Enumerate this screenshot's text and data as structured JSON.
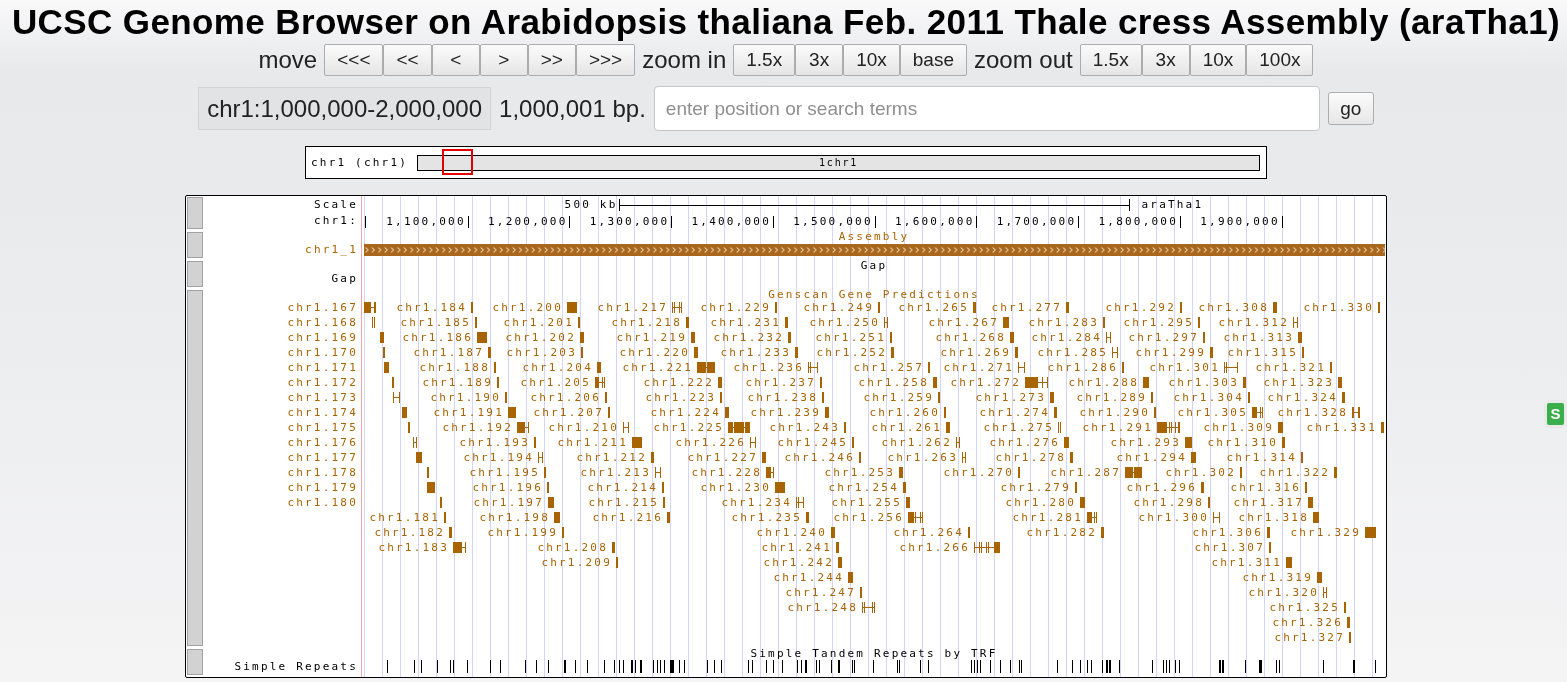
{
  "title": "UCSC Genome Browser on Arabidopsis thaliana Feb. 2011 Thale cress Assembly (araTha1)",
  "navigation": [
    {
      "label": "move",
      "buttons": [
        "<<<",
        "<<",
        "<",
        ">",
        ">>",
        ">>>"
      ]
    },
    {
      "label": "zoom in",
      "buttons": [
        "1.5x",
        "3x",
        "10x",
        "base"
      ]
    },
    {
      "label": "zoom out",
      "buttons": [
        "1.5x",
        "3x",
        "10x",
        "100x"
      ]
    }
  ],
  "position": {
    "value": "chr1:1,000,000-2,000,000",
    "size": "1,000,001 bp.",
    "search": {
      "placeholder": "enter position or search terms"
    },
    "go_button": "go"
  },
  "ideogram": {
    "label": "chr1 (chr1)",
    "band_label": "1chr1"
  },
  "tracks": [
    {
      "kind": "scale",
      "label": "Scale",
      "scale_bar": "500 kb",
      "assembly": "araTha1",
      "ruler_label": "chr1:",
      "ticks": [
        "1,100,000",
        "1,200,000",
        "1,300,000",
        "1,400,000",
        "1,500,000",
        "1,600,000",
        "1,700,000",
        "1,800,000",
        "1,900,000"
      ]
    },
    {
      "kind": "assembly",
      "title": "Assembly",
      "label": "chr1_1"
    },
    {
      "kind": "gap",
      "title": "Gap",
      "label": "Gap"
    },
    {
      "kind": "genes",
      "title": "Genscan Gene Predictions",
      "items": [
        "chr1.167",
        "chr1.184",
        "chr1.200",
        "chr1.217",
        "chr1.229",
        "chr1.249",
        "chr1.265",
        "chr1.277",
        "chr1.292",
        "chr1.308",
        "chr1.330",
        "chr1.168",
        "chr1.185",
        "chr1.201",
        "chr1.218",
        "chr1.231",
        "chr1.250",
        "chr1.267",
        "chr1.283",
        "chr1.295",
        "chr1.312",
        "chr1.169",
        "chr1.186",
        "chr1.202",
        "chr1.219",
        "chr1.232",
        "chr1.251",
        "chr1.268",
        "chr1.284",
        "chr1.297",
        "chr1.313",
        "chr1.170",
        "chr1.187",
        "chr1.203",
        "chr1.220",
        "chr1.233",
        "chr1.252",
        "chr1.269",
        "chr1.285",
        "chr1.299",
        "chr1.315",
        "chr1.171",
        "chr1.188",
        "chr1.204",
        "chr1.221",
        "chr1.236",
        "chr1.257",
        "chr1.271",
        "chr1.286",
        "chr1.301",
        "chr1.321",
        "chr1.172",
        "chr1.189",
        "chr1.205",
        "chr1.222",
        "chr1.237",
        "chr1.258",
        "chr1.272",
        "chr1.288",
        "chr1.303",
        "chr1.323",
        "chr1.173",
        "chr1.190",
        "chr1.206",
        "chr1.223",
        "chr1.238",
        "chr1.259",
        "chr1.273",
        "chr1.289",
        "chr1.304",
        "chr1.324",
        "chr1.174",
        "chr1.191",
        "chr1.207",
        "chr1.224",
        "chr1.239",
        "chr1.260",
        "chr1.274",
        "chr1.290",
        "chr1.305",
        "chr1.328",
        "chr1.175",
        "chr1.192",
        "chr1.210",
        "chr1.225",
        "chr1.243",
        "chr1.261",
        "chr1.275",
        "chr1.291",
        "chr1.309",
        "chr1.331",
        "chr1.176",
        "chr1.193",
        "chr1.211",
        "chr1.226",
        "chr1.245",
        "chr1.262",
        "chr1.276",
        "chr1.293",
        "chr1.310",
        "chr1.177",
        "chr1.194",
        "chr1.212",
        "chr1.227",
        "chr1.246",
        "chr1.263",
        "chr1.278",
        "chr1.294",
        "chr1.314",
        "chr1.178",
        "chr1.195",
        "chr1.213",
        "chr1.228",
        "chr1.253",
        "chr1.270",
        "chr1.287",
        "chr1.302",
        "chr1.322",
        "chr1.179",
        "chr1.196",
        "chr1.214",
        "chr1.230",
        "chr1.254",
        "chr1.279",
        "chr1.296",
        "chr1.316",
        "chr1.180",
        "chr1.197",
        "chr1.215",
        "chr1.234",
        "chr1.255",
        "chr1.280",
        "chr1.298",
        "chr1.317",
        "chr1.181",
        "chr1.198",
        "chr1.216",
        "chr1.235",
        "chr1.256",
        "chr1.281",
        "chr1.300",
        "chr1.318",
        "chr1.182",
        "chr1.199",
        "chr1.240",
        "chr1.264",
        "chr1.282",
        "chr1.306",
        "chr1.329",
        "chr1.183",
        "chr1.208",
        "chr1.241",
        "chr1.266",
        "chr1.307",
        "chr1.209",
        "chr1.242",
        "chr1.311",
        "chr1.244",
        "chr1.319",
        "chr1.247",
        "chr1.320",
        "chr1.248",
        "chr1.325",
        "chr1.326",
        "chr1.327"
      ]
    },
    {
      "kind": "repeats",
      "title": "Simple Tandem Repeats by TRF",
      "label": "Simple Repeats"
    }
  ],
  "side_widget": {
    "label": "S"
  }
}
